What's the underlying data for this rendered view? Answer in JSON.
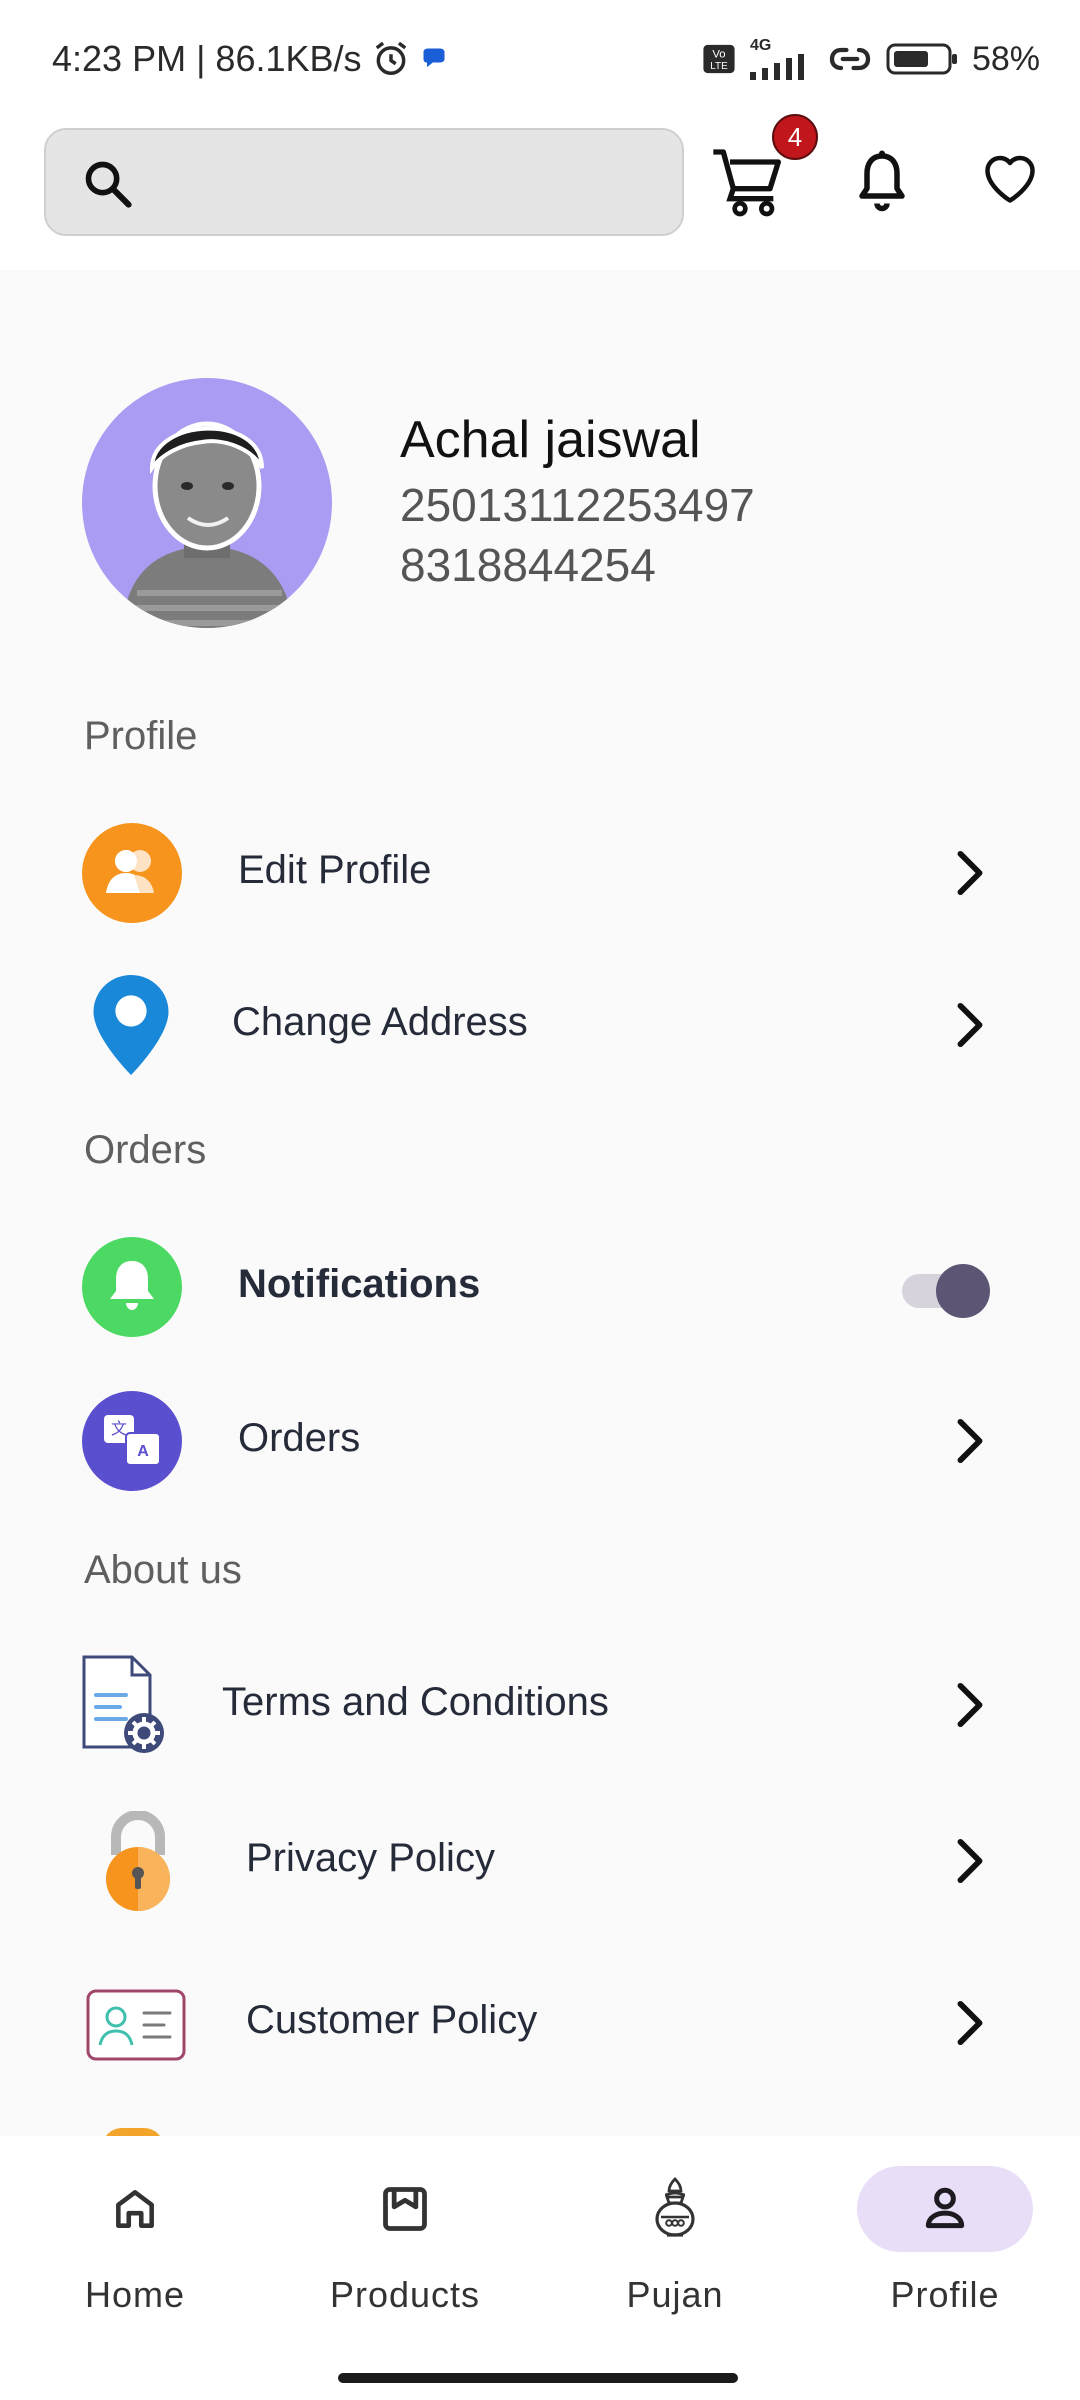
{
  "status_bar": {
    "time_speed": "4:23 PM | 86.1KB/s",
    "network_small": "4G",
    "volte": "Vo LTE",
    "battery": "58%"
  },
  "header": {
    "search": {
      "placeholder": ""
    },
    "cart_badge": "4"
  },
  "profile": {
    "name": "Achal jaiswal",
    "id": "25013112253497",
    "phone": "8318844254"
  },
  "sections": {
    "profile": "Profile",
    "orders": "Orders",
    "about": "About us"
  },
  "menu": {
    "edit_profile": "Edit Profile",
    "change_address": "Change Address",
    "notifications": "Notifications",
    "notifications_on": true,
    "orders": "Orders",
    "terms": "Terms and Conditions",
    "privacy": "Privacy Policy",
    "customer_policy": "Customer Policy"
  },
  "bottom_nav": {
    "items": [
      {
        "label": "Home",
        "icon": "home-icon"
      },
      {
        "label": "Products",
        "icon": "products-icon"
      },
      {
        "label": "Pujan",
        "icon": "kalash-icon"
      },
      {
        "label": "Profile",
        "icon": "person-icon",
        "active": true
      }
    ]
  },
  "colors": {
    "accent": "#e8def8",
    "badge": "#c0161c",
    "edit_profile_icon": "#f7941d",
    "location_pin": "#1a88d8",
    "notifications_icon": "#4cd963",
    "orders_icon": "#5a4fcf"
  }
}
